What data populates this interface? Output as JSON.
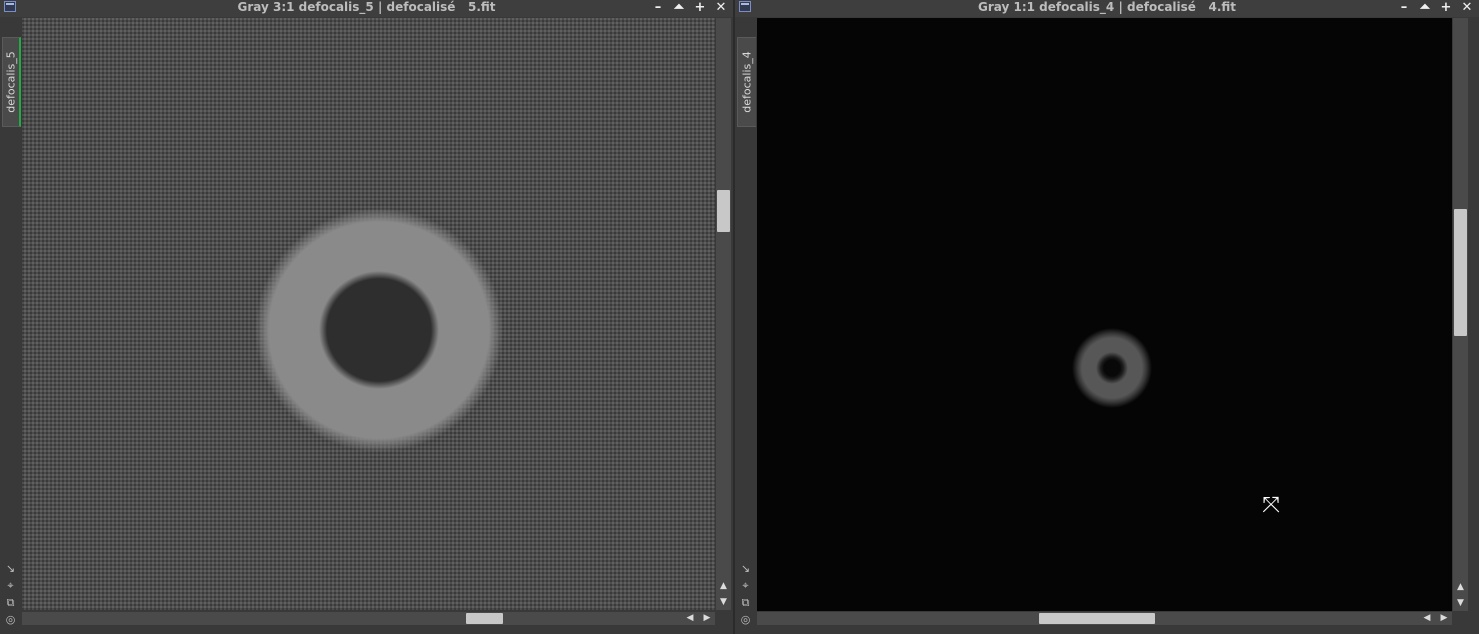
{
  "windows": [
    {
      "title": "Gray 3:1 defocalis_5 | defocalisé   5.fit",
      "tab_label": "defocalis_5"
    },
    {
      "title": "Gray 1:1 defocalis_4 | defocalisé   4.fit",
      "tab_label": "defocalis_4"
    }
  ],
  "controls": {
    "minimize": "–",
    "shade": "⏶",
    "maximize": "+",
    "close": "✕"
  },
  "tool_icons": [
    "↘",
    "⌖",
    "⧉",
    "◎"
  ],
  "scroll_arrows": {
    "up": "▲",
    "down": "▼",
    "left": "◀",
    "right": "▶"
  },
  "cursor": "⤧",
  "icons": {
    "cursor": "resize-cursor-icon"
  },
  "colors": {
    "window_bg": "#393939",
    "titlebar_text": "#bdbdbd",
    "active_tab_indicator": "#22aa44"
  }
}
